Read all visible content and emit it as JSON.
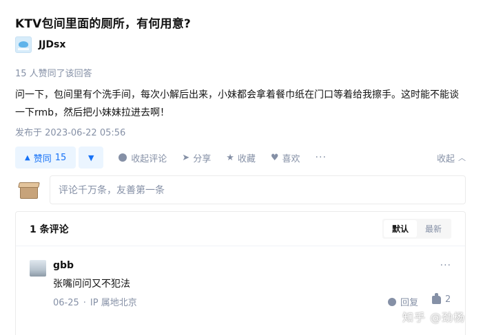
{
  "question": {
    "title": "KTV包间里面的厕所，有何用意?"
  },
  "author": {
    "name": "JJDsx"
  },
  "answer": {
    "vote_summary": "15 人赞同了该回答",
    "content": "问一下，包间里有个洗手间，每次小解后出来，小妹都会拿着餐巾纸在门口等着给我擦手。这时能不能谈一下rmb，然后把小妹妹拉进去啊！",
    "published": "发布于 2023-06-22 05:56"
  },
  "actions": {
    "upvote_label": "赞同",
    "upvote_count": "15",
    "collapse_comments": "收起评论",
    "share": "分享",
    "favorite": "收藏",
    "like": "喜欢",
    "more": "···",
    "collapse": "收起"
  },
  "comment_input": {
    "placeholder": "评论千万条，友善第一条"
  },
  "comments": {
    "count_label": "1 条评论",
    "sort": {
      "default": "默认",
      "latest": "最新"
    },
    "items": [
      {
        "author": "gbb",
        "text": "张嘴问问又不犯法",
        "date": "06-25",
        "location": "IP 属地北京",
        "reply_label": "回复",
        "likes": "2",
        "more": "···"
      }
    ]
  },
  "watermark": "知乎 @劲杨",
  "colors": {
    "accent": "#1772f6",
    "accent_bg": "#ebf5ff",
    "muted": "#8590a6"
  }
}
